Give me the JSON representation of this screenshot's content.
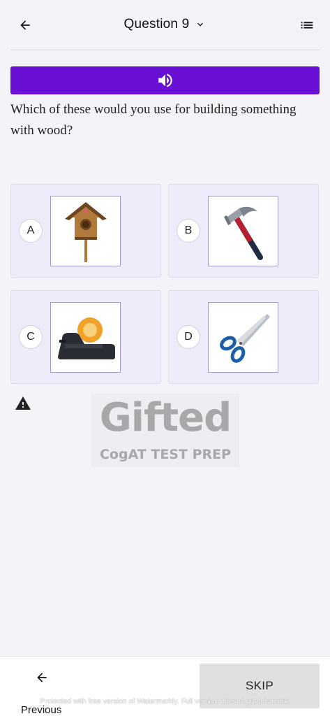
{
  "header": {
    "title": "Question 9",
    "back_icon": "arrow-left-icon",
    "dropdown_icon": "chevron-down-icon",
    "menu_icon": "list-icon"
  },
  "audio": {
    "icon": "speaker-icon",
    "color": "#6a0fd4"
  },
  "question": {
    "text": "Which of these would you use for building something with wood?"
  },
  "options": [
    {
      "letter": "A",
      "image": "birdhouse"
    },
    {
      "letter": "B",
      "image": "hammer"
    },
    {
      "letter": "C",
      "image": "tape-dispenser"
    },
    {
      "letter": "D",
      "image": "scissors"
    }
  ],
  "report_icon": "warning-icon",
  "logo": {
    "title": "Gifted",
    "subtitle": "CogAT TEST PREP"
  },
  "footer": {
    "previous_label": "Previous",
    "skip_label": "SKIP",
    "watermark_text": "Protected with free version of Watermarkly. Full version doesn't put this mark."
  }
}
